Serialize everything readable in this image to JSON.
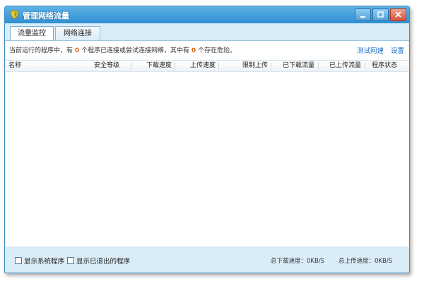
{
  "window": {
    "title": "管理网络流量"
  },
  "tabs": [
    {
      "label": "流量监控",
      "active": true
    },
    {
      "label": "网络连接",
      "active": false
    }
  ],
  "info": {
    "prefix": "当前运行的程序中，有",
    "connected_count": "0",
    "middle": "个程序已连接或尝试连接网络，其中有",
    "danger_count": "0",
    "suffix": "个存在危险。"
  },
  "links": {
    "speed_test": "测试网速",
    "settings": "设置"
  },
  "columns": [
    "名称",
    "安全等级",
    "下载速度",
    "上传速度",
    "限制上传",
    "已下载流量",
    "已上传流量",
    "程序状态"
  ],
  "footer": {
    "show_system": "显示系统程序",
    "show_exited": "显示已退出的程序",
    "download_speed": "总下载速度：0KB/S",
    "upload_speed": "总上传速度：0KB/S"
  },
  "colors": {
    "accent": "#2f8fd2",
    "count": "#e0641e",
    "link": "#1a6fc0"
  },
  "icons": {
    "title": "shield-icon",
    "min": "minimize-icon",
    "max": "maximize-icon",
    "close": "close-icon"
  }
}
